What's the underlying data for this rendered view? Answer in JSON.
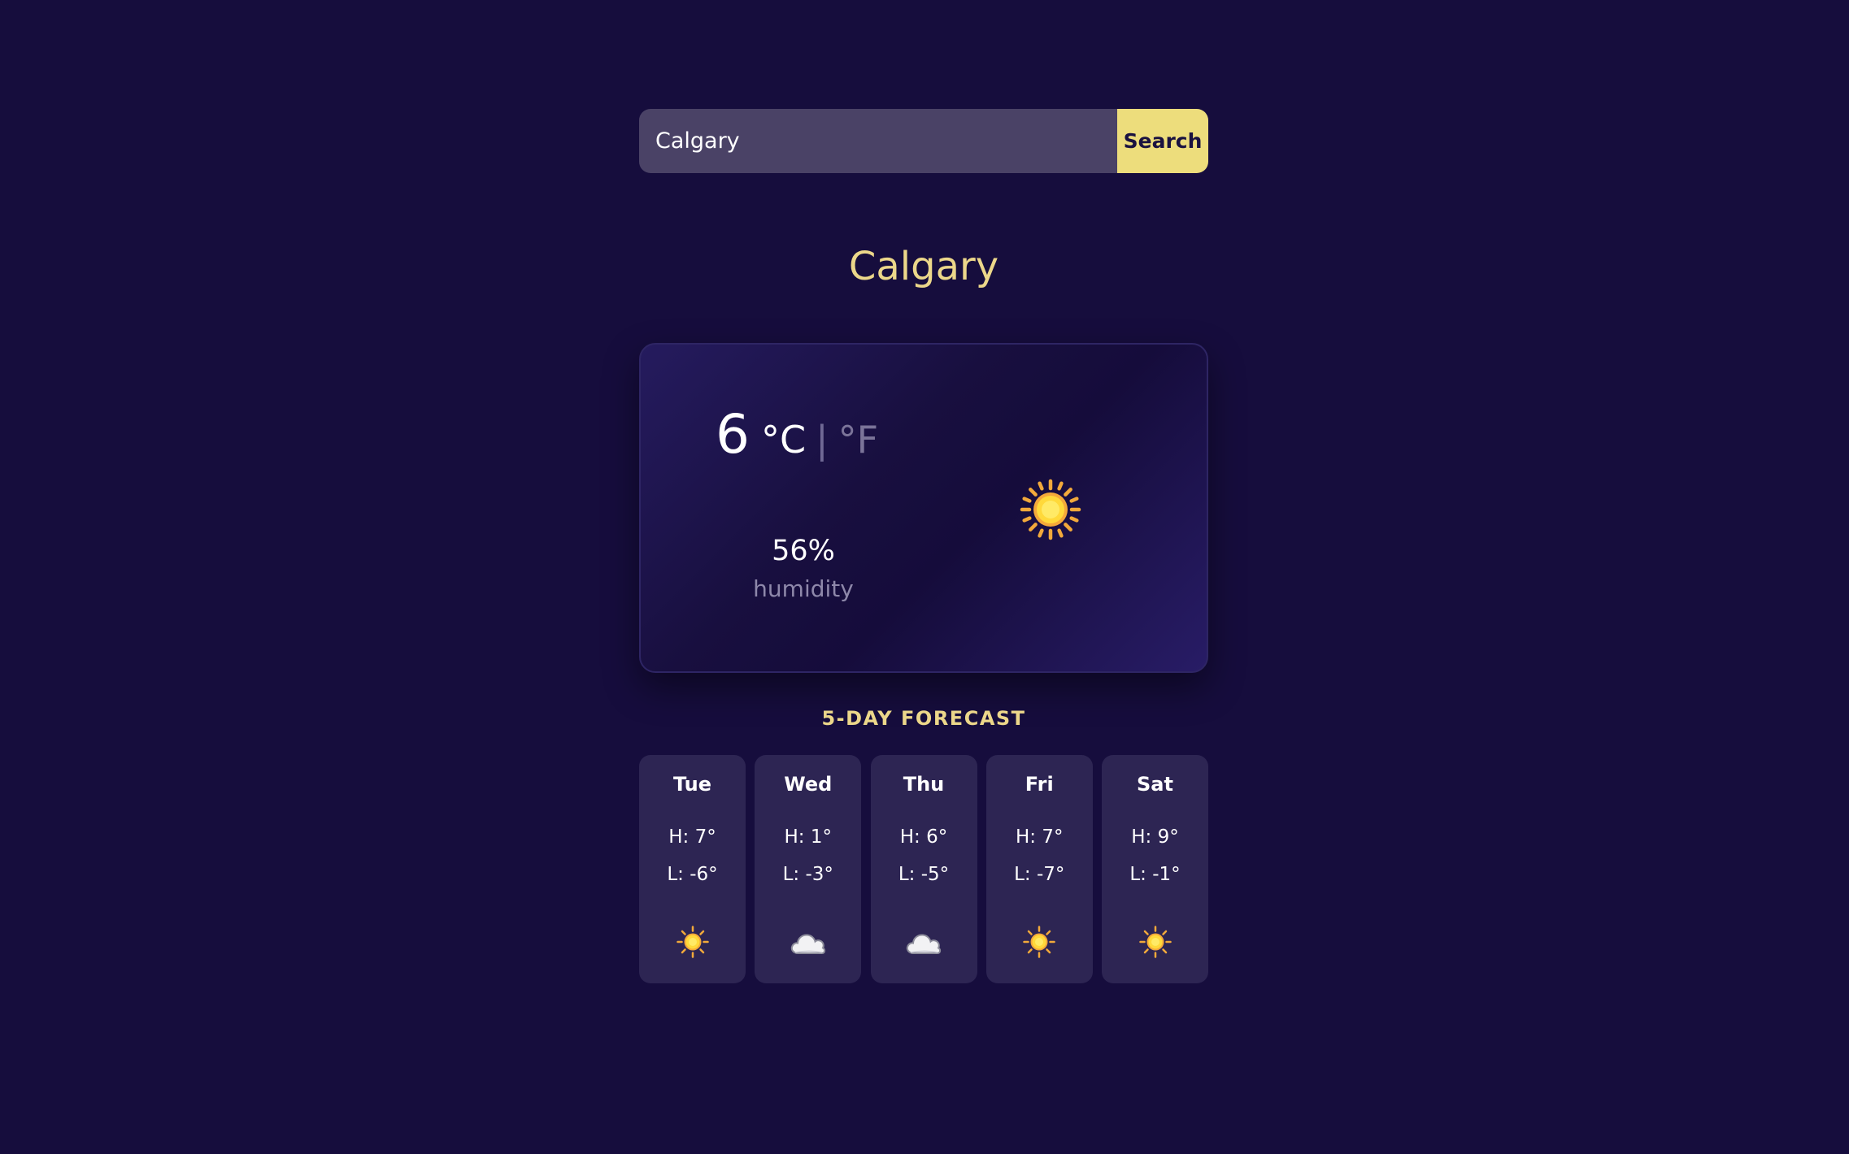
{
  "search": {
    "value": "Calgary",
    "button_label": "Search"
  },
  "current": {
    "city": "Calgary",
    "temperature": "6",
    "unit_celsius": "°C",
    "unit_separator": "|",
    "unit_fahrenheit": "°F",
    "active_unit": "celsius",
    "humidity_value": "56%",
    "humidity_label": "humidity",
    "icon": "sun-icon"
  },
  "forecast": {
    "heading": "5-DAY FORECAST",
    "days": [
      {
        "day": "Tue",
        "high": "H: 7°",
        "low": "L: -6°",
        "icon": "sun-icon"
      },
      {
        "day": "Wed",
        "high": "H: 1°",
        "low": "L: -3°",
        "icon": "cloud-icon"
      },
      {
        "day": "Thu",
        "high": "H: 6°",
        "low": "L: -5°",
        "icon": "cloud-icon"
      },
      {
        "day": "Fri",
        "high": "H: 7°",
        "low": "L: -7°",
        "icon": "sun-icon"
      },
      {
        "day": "Sat",
        "high": "H: 9°",
        "low": "L: -1°",
        "icon": "sun-icon"
      }
    ]
  },
  "colors": {
    "background": "#160d3d",
    "accent_yellow": "#eddd7c",
    "title_yellow": "#ecd78a",
    "card_bg": "#2d2553",
    "input_bg": "#4a4266"
  }
}
